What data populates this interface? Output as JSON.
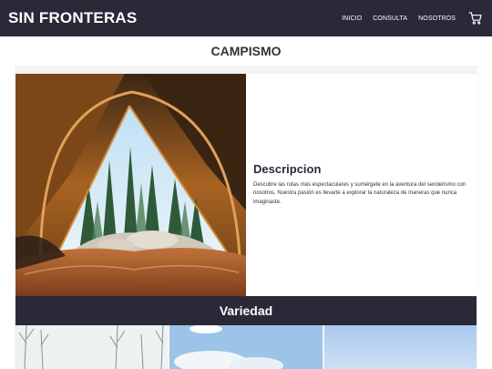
{
  "nav": {
    "brand": "SIN FRONTERAS",
    "links": [
      "INICIO",
      "CONSULTA",
      "NOSOTROS"
    ],
    "cart_icon": "cart-icon"
  },
  "page": {
    "title": "CAMPISMO"
  },
  "feature": {
    "image": "tent-forest-view",
    "heading": "Descripcion",
    "text": "Descubre las rutas más espectaculares y sumérgete en la aventura del senderismo con nosotros. Nuestra pasión es llevarte a explorar la naturaleza de maneras que nunca imaginaste."
  },
  "variety": {
    "heading": "Variedad",
    "tiles": [
      "bare-trees-sky",
      "sky-clouds",
      "blue-sky"
    ]
  },
  "colors": {
    "nav_bg": "#2b2838",
    "band_bg": "#2b2838",
    "page_bg": "#ffffff",
    "card_bg": "#f4f4f4"
  }
}
